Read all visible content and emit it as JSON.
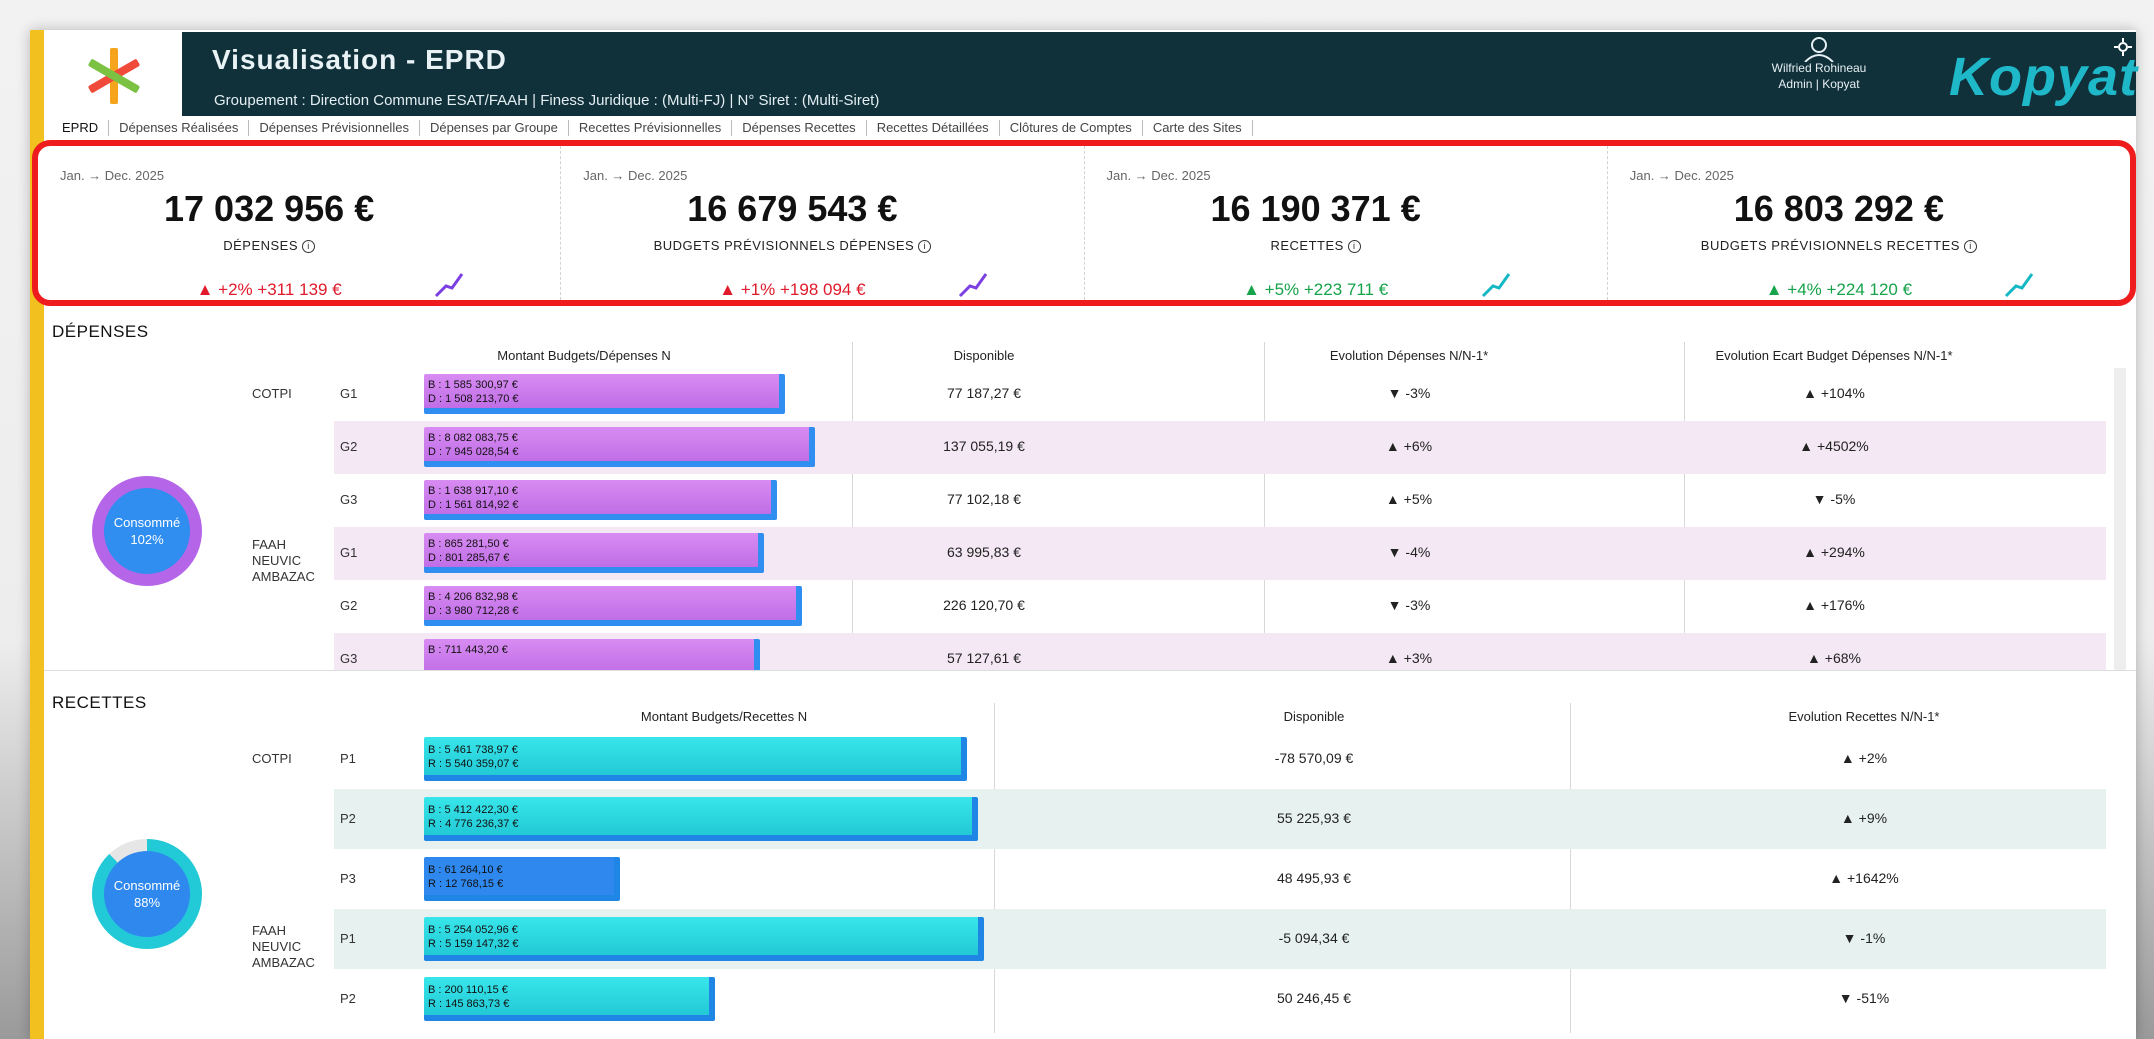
{
  "header": {
    "title": "Visualisation - EPRD",
    "subtitle": "Groupement : Direction Commune ESAT/FAAH | Finess Juridique : (Multi-FJ) | N° Siret : (Multi-Siret)",
    "user_name": "Wilfried Rohineau",
    "user_role": "Admin | Kopyat",
    "brand": "Kopyat"
  },
  "tabs": [
    "EPRD",
    "Dépenses Réalisées",
    "Dépenses Prévisionnelles",
    "Dépenses par Groupe",
    "Recettes Prévisionnelles",
    "Dépenses Recettes",
    "Recettes Détaillées",
    "Clôtures de Comptes",
    "Carte des Sites"
  ],
  "kpis": [
    {
      "period": "Jan. → Dec. 2025",
      "value": "17 032 956 €",
      "label": "DÉPENSES",
      "delta": "+2% +311 139 €",
      "trend": "up",
      "tone": "neg",
      "spark_color": "#7b3fe4"
    },
    {
      "period": "Jan. → Dec. 2025",
      "value": "16 679 543 €",
      "label": "BUDGETS PRÉVISIONNELS DÉPENSES",
      "delta": "+1% +198 094 €",
      "trend": "up",
      "tone": "neg",
      "spark_color": "#7b3fe4"
    },
    {
      "period": "Jan. → Dec. 2025",
      "value": "16 190 371 €",
      "label": "RECETTES",
      "delta": "+5% +223 711 €",
      "trend": "up",
      "tone": "pos",
      "spark_color": "#14b8c4"
    },
    {
      "period": "Jan. → Dec. 2025",
      "value": "16 803 292 €",
      "label": "BUDGETS PRÉVISIONNELS RECETTES",
      "delta": "+4% +224 120 €",
      "trend": "up",
      "tone": "pos",
      "spark_color": "#14b8c4"
    }
  ],
  "depenses": {
    "title": "DÉPENSES",
    "gauge_label": "Consommé",
    "gauge_value": "102%",
    "gauge_fraction": 1.02,
    "columns": [
      "Montant Budgets/Dépenses N",
      "Disponible",
      "Evolution Dépenses N/N-1*",
      "Evolution Ecart Budget Dépenses N/N-1*"
    ],
    "groups": [
      {
        "label": "COTPI",
        "row_start": 0
      },
      {
        "label": "FAAH NEUVIC AMBAZAC",
        "row_start": 3
      }
    ],
    "rows": [
      {
        "code": "G1",
        "budget": "B : 1 585 300,97 €",
        "depense": "D : 1 508 213,70 €",
        "fill": 0.86,
        "disponible": "77 187,27 €",
        "evol": "-3%",
        "evol_dir": "down",
        "evol_tone": "pos",
        "ecart": "+104%",
        "ecart_dir": "up",
        "ecart_tone": "pos"
      },
      {
        "code": "G2",
        "budget": "B : 8 082 083,75 €",
        "depense": "D : 7 945 028,54 €",
        "fill": 0.93,
        "disponible": "137 055,19 €",
        "evol": "+6%",
        "evol_dir": "up",
        "evol_tone": "neg",
        "ecart": "+4502%",
        "ecart_dir": "up",
        "ecart_tone": "pos"
      },
      {
        "code": "G3",
        "budget": "B : 1 638 917,10 €",
        "depense": "D : 1 561 814,92 €",
        "fill": 0.84,
        "disponible": "77 102,18 €",
        "evol": "+5%",
        "evol_dir": "up",
        "evol_tone": "neg",
        "ecart": "-5%",
        "ecart_dir": "down",
        "ecart_tone": "pos"
      },
      {
        "code": "G1",
        "budget": "B : 865 281,50 €",
        "depense": "D : 801 285,67 €",
        "fill": 0.81,
        "disponible": "63 995,83 €",
        "evol": "-4%",
        "evol_dir": "down",
        "evol_tone": "pos",
        "ecart": "+294%",
        "ecart_dir": "up",
        "ecart_tone": "pos"
      },
      {
        "code": "G2",
        "budget": "B : 4 206 832,98 €",
        "depense": "D : 3 980 712,28 €",
        "fill": 0.9,
        "disponible": "226 120,70 €",
        "evol": "-3%",
        "evol_dir": "down",
        "evol_tone": "pos",
        "ecart": "+176%",
        "ecart_dir": "up",
        "ecart_tone": "pos"
      },
      {
        "code": "G3",
        "budget": "B : 711 443,20 €",
        "depense": "",
        "fill": 0.8,
        "disponible": "57 127,61 €",
        "evol": "+3%",
        "evol_dir": "up",
        "evol_tone": "neg",
        "ecart": "+68%",
        "ecart_dir": "up",
        "ecart_tone": "pos"
      }
    ]
  },
  "recettes": {
    "title": "RECETTES",
    "gauge_label": "Consommé",
    "gauge_value": "88%",
    "gauge_fraction": 0.88,
    "columns": [
      "Montant Budgets/Recettes N",
      "Disponible",
      "Evolution Recettes N/N-1*"
    ],
    "groups": [
      {
        "label": "COTPI",
        "row_start": 0
      },
      {
        "label": "FAAH NEUVIC AMBAZAC",
        "row_start": 3
      }
    ],
    "rows": [
      {
        "code": "P1",
        "budget": "B : 5 461 738,97 €",
        "recette": "R : 5 540 359,07 €",
        "fill": 0.97,
        "disponible": "-78 570,09 €",
        "evol": "+2%",
        "evol_dir": "up",
        "evol_tone": "pos",
        "style": "teal"
      },
      {
        "code": "P2",
        "budget": "B : 5 412 422,30 €",
        "recette": "R : 4 776 236,37 €",
        "fill": 0.99,
        "disponible": "55 225,93 €",
        "evol": "+9%",
        "evol_dir": "up",
        "evol_tone": "pos",
        "style": "teal"
      },
      {
        "code": "P3",
        "budget": "B : 61 264,10 €",
        "recette": "R : 12 768,15 €",
        "fill": 0.35,
        "disponible": "48 495,93 €",
        "evol": "+1642%",
        "evol_dir": "up",
        "evol_tone": "pos",
        "style": "blue"
      },
      {
        "code": "P1",
        "budget": "B : 5 254 052,96 €",
        "recette": "R : 5 159 147,32 €",
        "fill": 1.0,
        "disponible": "-5 094,34 €",
        "evol": "-1%",
        "evol_dir": "down",
        "evol_tone": "neg",
        "style": "teal"
      },
      {
        "code": "P2",
        "budget": "B : 200 110,15 €",
        "recette": "R : 145 863,73 €",
        "fill": 0.52,
        "disponible": "50 246,45 €",
        "evol": "-51%",
        "evol_dir": "down",
        "evol_tone": "neg",
        "style": "teal"
      }
    ]
  },
  "colors": {
    "header_bg": "#10303a",
    "accent_yellow": "#f2c01f",
    "highlight_red": "#ee1c1c",
    "negative": "#e01a2a",
    "positive": "#16a34a",
    "depense_bar": "#c06ee6",
    "recette_bar": "#22c9d6"
  }
}
